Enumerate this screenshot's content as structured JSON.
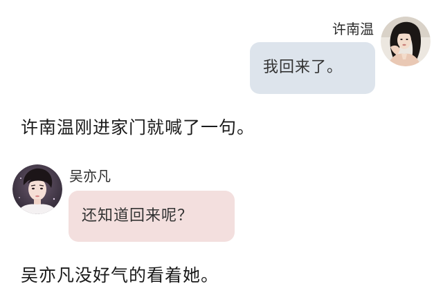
{
  "messages": [
    {
      "side": "right",
      "sender": "许南温",
      "text": "我回来了。",
      "bubble_color": "#dde4ec",
      "avatar_icon": "female-avatar-photo"
    },
    {
      "side": "left",
      "sender": "吴亦凡",
      "text": "还知道回来呢？",
      "bubble_color": "#f3dfde",
      "avatar_icon": "male-avatar-photo"
    }
  ],
  "narration": [
    "许南温刚进家门就喊了一句。",
    "吴亦凡没好气的看着她。"
  ]
}
